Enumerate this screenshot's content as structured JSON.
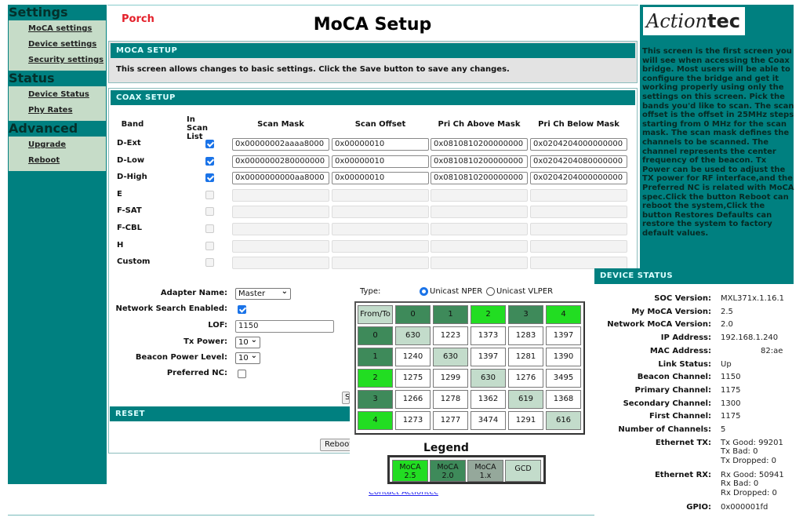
{
  "sidebar": {
    "groups": [
      {
        "title": "Settings",
        "items": [
          "MoCA settings",
          "Device settings",
          "Security settings"
        ]
      },
      {
        "title": "Status",
        "items": [
          "Device Status",
          "Phy Rates"
        ]
      },
      {
        "title": "Advanced",
        "items": [
          "Upgrade",
          "Reboot"
        ]
      }
    ]
  },
  "header": {
    "location": "Porch",
    "title": "MoCA Setup"
  },
  "moca_setup": {
    "heading": "MOCA SETUP",
    "description": "This screen allows changes to basic settings. Click the Save button to save any changes."
  },
  "coax": {
    "heading": "COAX SETUP",
    "columns": [
      "Band",
      "In Scan List",
      "Scan Mask",
      "Scan Offset",
      "Pri Ch Above Mask",
      "Pri Ch Below Mask"
    ],
    "rows": [
      {
        "band": "D-Ext",
        "checked": true,
        "enabled": true,
        "scan_mask": "0x00000002aaaa8000",
        "scan_offset": "0x00000010",
        "above": "0x0810810200000000",
        "below": "0x0204204000000000"
      },
      {
        "band": "D-Low",
        "checked": true,
        "enabled": true,
        "scan_mask": "0x0000000280000000",
        "scan_offset": "0x00000010",
        "above": "0x0810810200000000",
        "below": "0x0204204080000000"
      },
      {
        "band": "D-High",
        "checked": true,
        "enabled": true,
        "scan_mask": "0x0000000000aa8000",
        "scan_offset": "0x00000010",
        "above": "0x0810810200000000",
        "below": "0x0204204000000000"
      },
      {
        "band": "E",
        "checked": false,
        "enabled": false,
        "scan_mask": "",
        "scan_offset": "",
        "above": "",
        "below": ""
      },
      {
        "band": "F-SAT",
        "checked": false,
        "enabled": false,
        "scan_mask": "",
        "scan_offset": "",
        "above": "",
        "below": ""
      },
      {
        "band": "F-CBL",
        "checked": false,
        "enabled": false,
        "scan_mask": "",
        "scan_offset": "",
        "above": "",
        "below": ""
      },
      {
        "band": "H",
        "checked": false,
        "enabled": false,
        "scan_mask": "",
        "scan_offset": "",
        "above": "",
        "below": ""
      },
      {
        "band": "Custom",
        "checked": false,
        "enabled": false,
        "scan_mask": "",
        "scan_offset": "",
        "above": "",
        "below": ""
      }
    ]
  },
  "form": {
    "adapter_name_label": "Adapter Name:",
    "adapter_name": "Master",
    "network_search_label": "Network Search Enabled:",
    "network_search": true,
    "lof_label": "LOF:",
    "lof": "1150",
    "tx_power_label": "Tx Power:",
    "tx_power": "10",
    "beacon_power_label": "Beacon Power Level:",
    "beacon_power": "10",
    "preferred_nc_label": "Preferred NC:",
    "preferred_nc": false,
    "save_label": "Save"
  },
  "reset": {
    "heading": "RESET",
    "reboot_label": "Reboot"
  },
  "footer": {
    "contact_label": "Contact Actiontec"
  },
  "help_text": "This screen is the first screen you will see when accessing the Coax bridge. Most users will be able to configure the bridge and get it working properly using only the settings on this screen. Pick the bands you'd like to scan. The scan offset is the offset in 25MHz steps starting from 0 MHz for the scan mask. The scan mask defines the channels to be scanned. The channel represents the center frequency of the beacon. Tx Power can be used to adjust the TX power for RF interface,and the Preferred NC is related with MoCA spec.Click the button Reboot can reboot the system,Click the button Restores Defaults can restore the system to factory default values.",
  "logo": "Actiontec",
  "phy_rates": {
    "type_label": "Type:",
    "options": [
      {
        "label": "Unicast NPER",
        "selected": true
      },
      {
        "label": "Unicast VLPER",
        "selected": false
      }
    ],
    "corner": "From/To",
    "nodes": [
      {
        "id": "0",
        "version": "2.0"
      },
      {
        "id": "1",
        "version": "2.0"
      },
      {
        "id": "2",
        "version": "2.5"
      },
      {
        "id": "3",
        "version": "2.0"
      },
      {
        "id": "4",
        "version": "2.5"
      }
    ],
    "matrix": [
      [
        630,
        1223,
        1373,
        1283,
        1397
      ],
      [
        1240,
        630,
        1397,
        1281,
        1390
      ],
      [
        1275,
        1299,
        630,
        1276,
        3495
      ],
      [
        1266,
        1278,
        1362,
        619,
        1368
      ],
      [
        1273,
        1277,
        3474,
        1291,
        616
      ]
    ],
    "legend_title": "Legend",
    "legend": [
      {
        "line1": "MoCA",
        "line2": "2.5",
        "color": "#22dd22"
      },
      {
        "line1": "MoCA",
        "line2": "2.0",
        "color": "#3e8a5a"
      },
      {
        "line1": "MoCA",
        "line2": "1.x",
        "color": "#95a89b"
      },
      {
        "line1": "GCD",
        "line2": "",
        "color": "#c3dccb"
      }
    ]
  },
  "device_status": {
    "heading": "DEVICE STATUS",
    "fields": [
      {
        "label": "SOC Version:",
        "value": [
          "MXL371x.1.16.1"
        ]
      },
      {
        "label": "My MoCA Version:",
        "value": [
          "2.5"
        ]
      },
      {
        "label": "Network MoCA Version:",
        "value": [
          "2.0"
        ]
      },
      {
        "label": "IP Address:",
        "value": [
          "192.168.1.240"
        ]
      },
      {
        "label": "MAC Address:",
        "value": [
          "82:ae"
        ]
      },
      {
        "label": "Link Status:",
        "value": [
          "Up"
        ]
      },
      {
        "label": "Beacon Channel:",
        "value": [
          "1150"
        ]
      },
      {
        "label": "Primary Channel:",
        "value": [
          "1175"
        ]
      },
      {
        "label": "Secondary Channel:",
        "value": [
          "1300"
        ]
      },
      {
        "label": "First Channel:",
        "value": [
          "1175"
        ]
      },
      {
        "label": "Number of Channels:",
        "value": [
          "5"
        ]
      },
      {
        "label": "Ethernet TX:",
        "value": [
          "Tx Good: 99201",
          "Tx Bad: 0",
          "Tx Dropped: 0"
        ]
      },
      {
        "label": "Ethernet RX:",
        "value": [
          "Rx Good: 50941",
          "Rx Bad: 0",
          "Rx Dropped: 0"
        ]
      },
      {
        "label": "GPIO:",
        "value": [
          "0x000001fd"
        ]
      }
    ]
  },
  "colors": {
    "teal": "#008080",
    "sidebar_group": "#c6dcc8",
    "moca25": "#22dd22",
    "moca20": "#3e8a5a",
    "moca1x": "#95a89b",
    "gcd": "#c3dccb"
  }
}
